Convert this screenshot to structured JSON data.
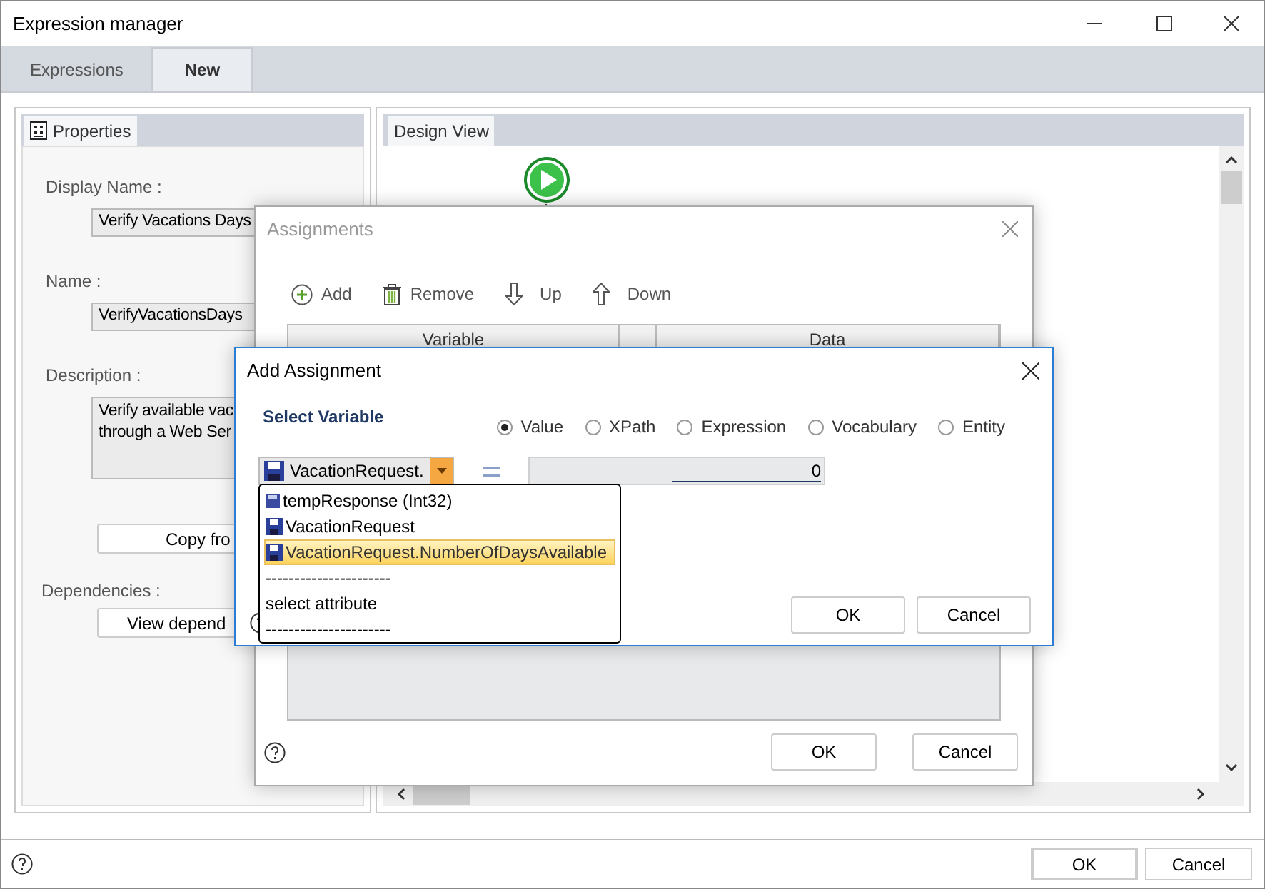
{
  "window": {
    "title": "Expression manager"
  },
  "tabs": [
    {
      "label": "Expressions",
      "selected": false
    },
    {
      "label": "New",
      "selected": true
    }
  ],
  "properties_panel": {
    "tab": "Properties",
    "fields": [
      {
        "label": "Display Name :",
        "value": "Verify Vacations Days"
      },
      {
        "label": "Name :",
        "value": "VerifyVacationsDays"
      }
    ],
    "description": {
      "label": "Description :",
      "lines": [
        "Verify available vac",
        "through a Web Ser"
      ]
    },
    "copy_button": "Copy fro",
    "dependencies": {
      "label": "Dependencies :",
      "button": "View depend"
    }
  },
  "design_panel": {
    "tab": "Design View"
  },
  "assignments_dialog": {
    "title": "Assignments",
    "toolbar": [
      {
        "label": "Add",
        "kind": "add"
      },
      {
        "label": "Remove",
        "kind": "remove"
      },
      {
        "label": "Up",
        "kind": "up"
      },
      {
        "label": "Down",
        "kind": "down"
      }
    ],
    "columns": [
      "Variable",
      "Data"
    ],
    "buttons": [
      "OK",
      "Cancel"
    ]
  },
  "add_assignment_dialog": {
    "title": "Add Assignment",
    "section": "Select Variable",
    "modes": [
      {
        "label": "Value",
        "selected": true
      },
      {
        "label": "XPath",
        "selected": false
      },
      {
        "label": "Expression",
        "selected": false
      },
      {
        "label": "Vocabulary",
        "selected": false
      },
      {
        "label": "Entity",
        "selected": false
      }
    ],
    "variable": "VacationRequest.",
    "value": "0",
    "dropdown": [
      {
        "label": "tempResponse (Int32)",
        "kind": "scalar",
        "selected": false
      },
      {
        "label": "VacationRequest",
        "kind": "object",
        "selected": false
      },
      {
        "label": "VacationRequest.NumberOfDaysAvailable",
        "kind": "object",
        "selected": true
      },
      {
        "label": "----------------------",
        "kind": "text",
        "selected": false
      },
      {
        "label": "select attribute",
        "kind": "text",
        "selected": false
      },
      {
        "label": "----------------------",
        "kind": "text",
        "selected": false
      }
    ],
    "buttons": [
      "OK",
      "Cancel"
    ]
  },
  "footer": {
    "buttons": [
      "OK",
      "Cancel"
    ]
  }
}
